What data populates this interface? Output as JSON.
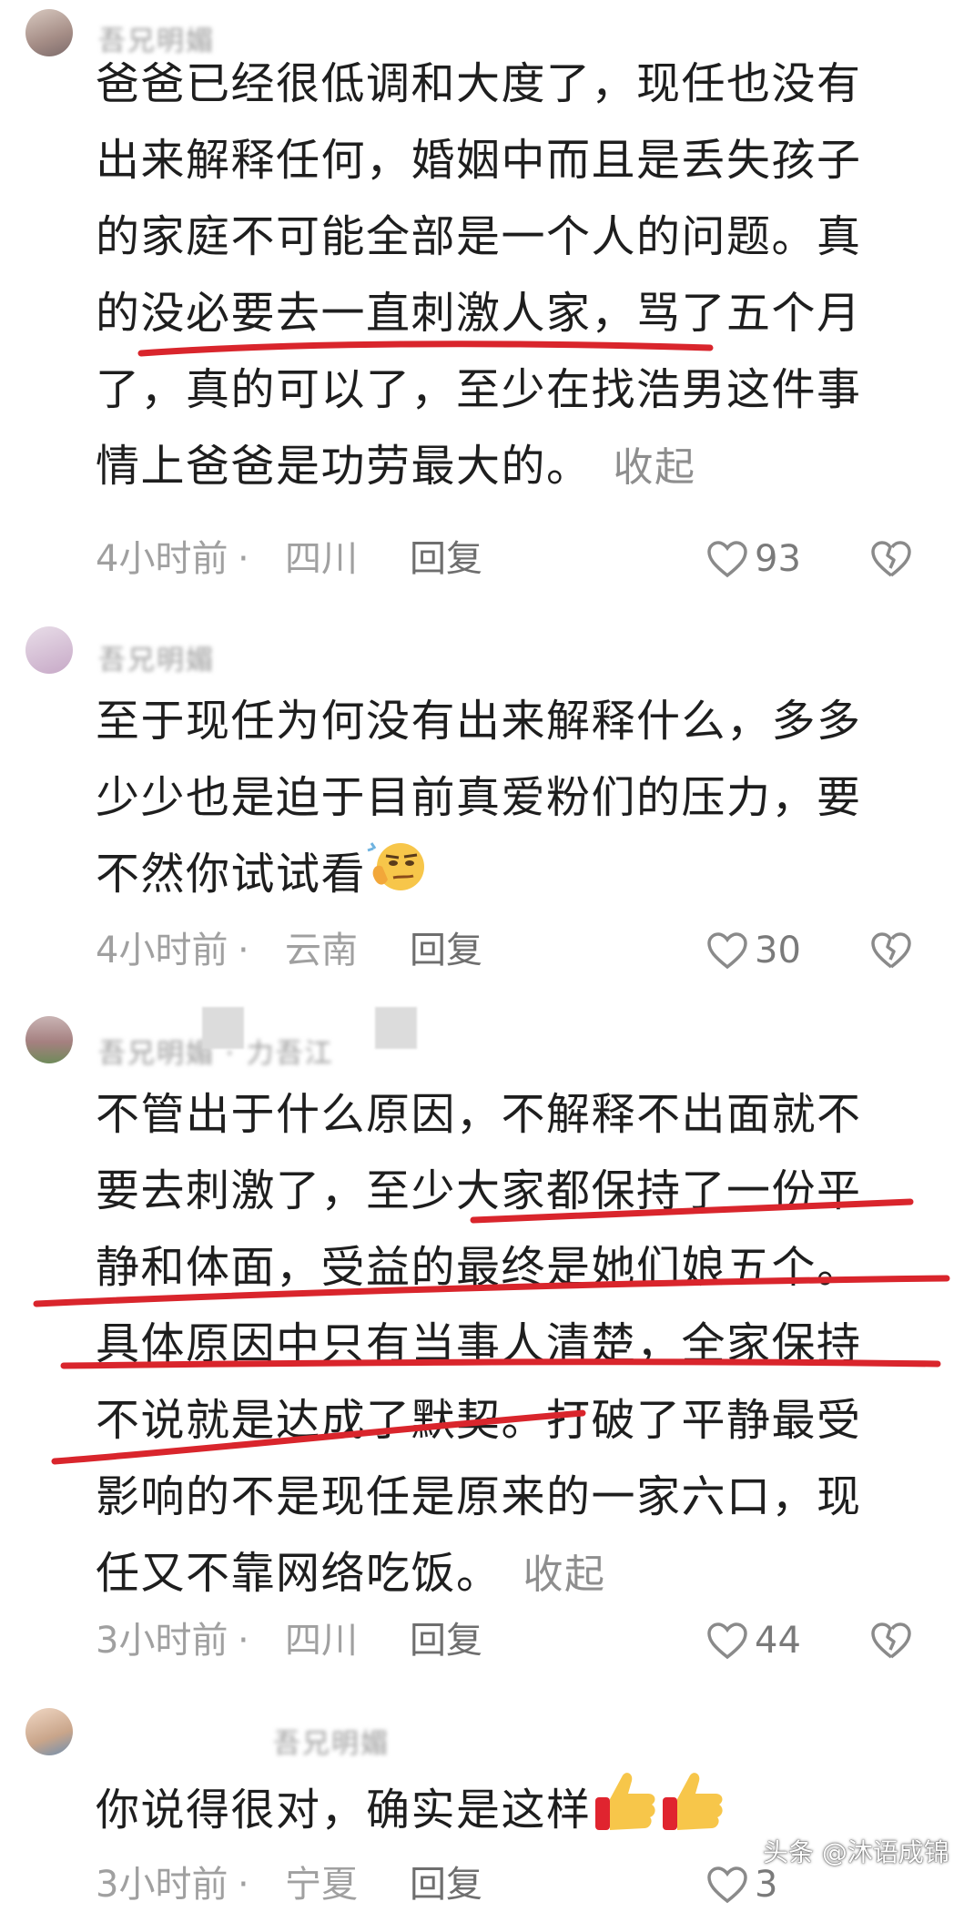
{
  "comments": [
    {
      "username": "吾兄明媚",
      "text": "爸爸已经很低调和大度了，现任也没有出来解释任何，婚姻中而且是丢失孩子的家庭不可能全部是一个人的问题。真的没必要去一直刺激人家，骂了五个月了，真的可以了，至少在找浩男这件事情上爸爸是功劳最大的。",
      "collapse_label": "收起",
      "time": "4小时前",
      "location": "四川",
      "reply_label": "回复",
      "likes": "93"
    },
    {
      "username": "吾兄明媚",
      "text": "至于现任为何没有出来解释什么，多多少少也是迫于目前真爱粉们的压力，要不然你试试看",
      "emoji": "thinking-face-emoji",
      "time": "4小时前",
      "location": "云南",
      "reply_label": "回复",
      "likes": "30"
    },
    {
      "username": "吾兄明媚 · 力吾江",
      "text": "不管出于什么原因，不解释不出面就不要去刺激了，至少大家都保持了一份平静和体面，受益的最终是她们娘五个。具体原因中只有当事人清楚，全家保持不说就是达成了默契。打破了平静最受影响的不是现任是原来的一家六口，现任又不靠网络吃饭。",
      "collapse_label": "收起",
      "time": "3小时前",
      "location": "四川",
      "reply_label": "回复",
      "likes": "44"
    },
    {
      "username": "吾兄明媚",
      "text": "你说得很对，确实是这样",
      "emoji": "thumbs-up-emoji",
      "time": "3小时前",
      "location": "宁夏",
      "reply_label": "回复",
      "likes": "3"
    }
  ],
  "separator": "·",
  "watermark": "头条 @沐语成锦",
  "colors": {
    "underline": "#d9252c",
    "meta": "#a0a0a0",
    "text": "#1e1e1e"
  }
}
